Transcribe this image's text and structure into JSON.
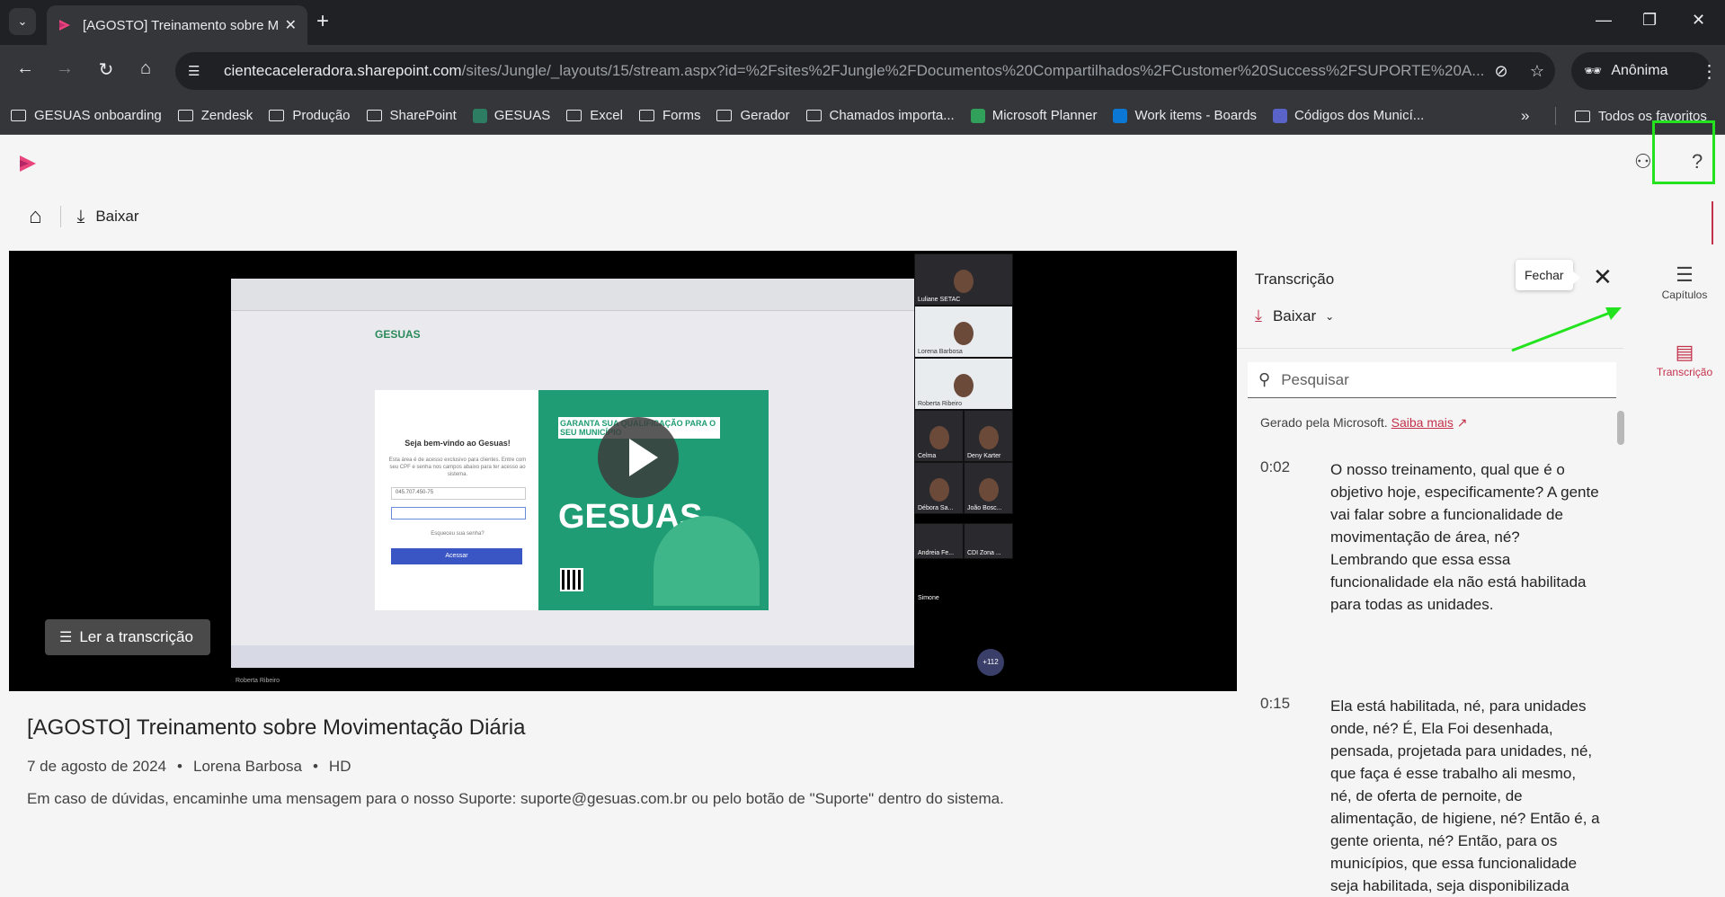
{
  "browser": {
    "tab_title": "[AGOSTO] Treinamento sobre M",
    "url_host": "cientecaceleradora.sharepoint.com",
    "url_path": "/sites/Jungle/_layouts/15/stream.aspx?id=%2Fsites%2FJungle%2FDocumentos%20Compartilhados%2FCustomer%20Success%2FSUPORTE%20A...",
    "profile_label": "Anônima",
    "bookmarks": [
      {
        "label": "GESUAS onboarding",
        "icon": "folder"
      },
      {
        "label": "Zendesk",
        "icon": "folder"
      },
      {
        "label": "Produção",
        "icon": "folder"
      },
      {
        "label": "SharePoint",
        "icon": "folder"
      },
      {
        "label": "GESUAS",
        "icon": "gesuas"
      },
      {
        "label": "Excel",
        "icon": "folder"
      },
      {
        "label": "Forms",
        "icon": "folder"
      },
      {
        "label": "Gerador",
        "icon": "folder"
      },
      {
        "label": "Chamados importa...",
        "icon": "folder"
      },
      {
        "label": "Microsoft Planner",
        "icon": "planner"
      },
      {
        "label": "Work items - Boards",
        "icon": "devops"
      },
      {
        "label": "Códigos dos Municí...",
        "icon": "link"
      }
    ],
    "all_bookmarks_label": "Todos os favoritos"
  },
  "app": {
    "download_label": "Baixar"
  },
  "video": {
    "read_transcript_label": "Ler a transcrição",
    "title": "[AGOSTO] Treinamento sobre Movimentação Diária",
    "date": "7 de agosto de 2024",
    "author": "Lorena Barbosa",
    "quality": "HD",
    "description": "Em caso de dúvidas, encaminhe uma mensagem para o nosso Suporte: suporte@gesuas.com.br ou pelo botão de \"Suporte\" dentro do sistema.",
    "screen": {
      "brand": "GESUAS",
      "welcome": "Seja bem-vindo ao Gesuas!",
      "intro": "Esta área é de acesso exclusivo para clientes. Entre com seu CPF e senha nos campos abaixo para ter acesso ao sistema.",
      "cpf": "045.707.450-75",
      "forgot": "Esqueceu sua senha?",
      "access": "Acessar",
      "promo_top": "GARANTA SUA QUALIFICAÇÃO PARA O SEU MUNICÍPIO",
      "promo_big": "GESUAS",
      "bottom_name": "Roberta Ribeiro"
    },
    "participants": [
      {
        "name": "Luliane SETAC"
      },
      {
        "name": "Lorena Barbosa"
      },
      {
        "name": "Roberta Ribeiro"
      },
      {
        "name": "Celma"
      },
      {
        "name": "Deny Karter"
      },
      {
        "name": "Débora Sa..."
      },
      {
        "name": "João Bosc..."
      },
      {
        "name": "Andreia Fe..."
      },
      {
        "name": "CDI Zona ..."
      },
      {
        "name": "Simone"
      }
    ],
    "more_participants": "+112"
  },
  "transcript": {
    "title": "Transcrição",
    "close_tooltip": "Fechar",
    "download_label": "Baixar",
    "search_placeholder": "Pesquisar",
    "generated_by": "Gerado pela Microsoft.",
    "learn_more": "Saiba mais",
    "entries": [
      {
        "time": "0:02",
        "text": "O nosso treinamento, qual que é o objetivo hoje, especificamente? A gente vai falar sobre a funcionalidade de movimentação de área, né? Lembrando que essa essa funcionalidade ela não está habilitada para todas as unidades."
      },
      {
        "time": "0:15",
        "text": "Ela está habilitada, né, para unidades onde, né? É, Ela Foi desenhada, pensada, projetada para unidades, né, que faça é esse trabalho ali mesmo, né, de oferta de pernoite, de alimentação, de higiene, né? Então é, a gente orienta, né? Então, para os municípios, que essa funcionalidade seja habilitada, seja disponibilizada"
      }
    ]
  },
  "rail": {
    "chapters_label": "Capítulos",
    "transcript_label": "Transcrição"
  },
  "colors": {
    "accent": "#c4314b",
    "highlight": "#22e31d",
    "chrome_dark": "#202124",
    "chrome_mid": "#35363a"
  }
}
